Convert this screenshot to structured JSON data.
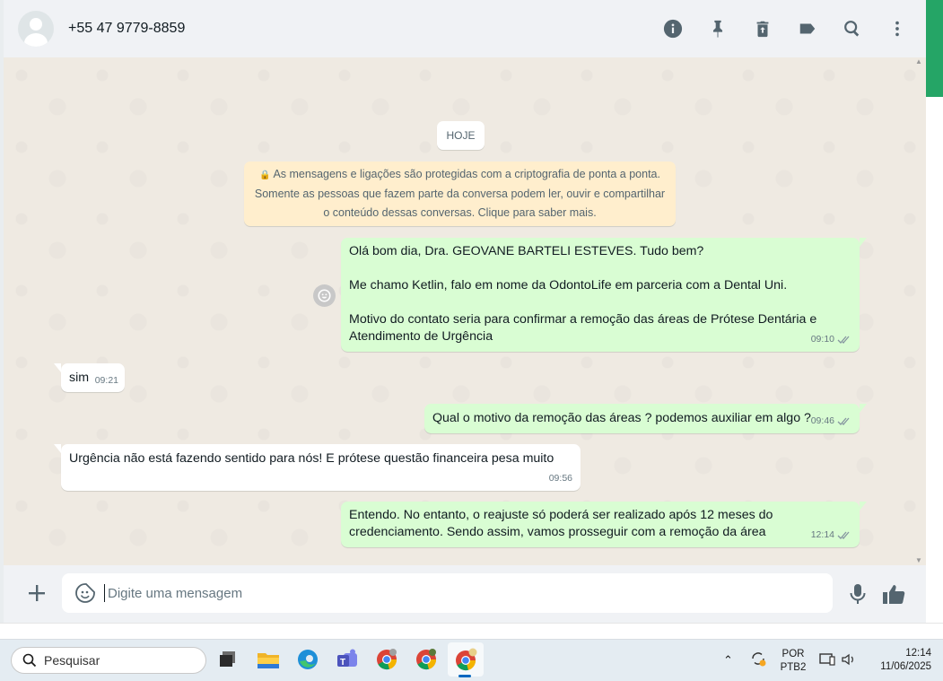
{
  "header": {
    "contact": "+55 47 9779-8859",
    "icons": [
      "info-icon",
      "pin-icon",
      "delete-icon",
      "label-icon",
      "search-icon",
      "menu-icon"
    ]
  },
  "chat": {
    "date_chip": "HOJE",
    "encryption_notice": [
      "As mensagens e ligações são protegidas com a criptografia de ponta a ponta.",
      "Somente as pessoas que fazem parte da conversa podem ler, ouvir e compartilhar",
      "o conteúdo dessas conversas. Clique para saber mais."
    ],
    "messages": [
      {
        "dir": "out",
        "lines": [
          "Olá bom dia, Dra. GEOVANE BARTELI ESTEVES. Tudo bem?",
          "",
          "Me chamo Ketlin, falo em nome da OdontoLife em parceria com a Dental Uni.",
          "",
          "Motivo do contato seria para confirmar a remoção das áreas de Prótese Dentária e",
          "Atendimento de Urgência"
        ],
        "time": "09:10",
        "status": "read"
      },
      {
        "dir": "in",
        "lines": [
          "sim"
        ],
        "time": "09:21"
      },
      {
        "dir": "out",
        "lines": [
          "Qual o motivo da remoção das áreas ? podemos auxiliar em algo ?"
        ],
        "time": "09:46",
        "status": "read"
      },
      {
        "dir": "in",
        "lines": [
          "Urgência não está fazendo sentido para nós! E prótese questão financeira pesa muito"
        ],
        "time": "09:56"
      },
      {
        "dir": "out",
        "lines": [
          "Entendo. No entanto, o reajuste só poderá ser realizado após 12 meses do",
          "credenciamento. Sendo assim, vamos prosseguir com a remoção da área"
        ],
        "time": "12:14",
        "status": "read"
      }
    ]
  },
  "composer": {
    "placeholder": "Digite uma mensagem"
  },
  "taskbar": {
    "search_label": "Pesquisar",
    "lang_line1": "POR",
    "lang_line2": "PTB2",
    "clock_time": "12:14",
    "clock_date": "11/06/2025"
  },
  "colors": {
    "outgoing_bubble": "#d9fdd3",
    "incoming_bubble": "#ffffff",
    "read_ticks": "#8696a0",
    "accent": "#25a566"
  }
}
